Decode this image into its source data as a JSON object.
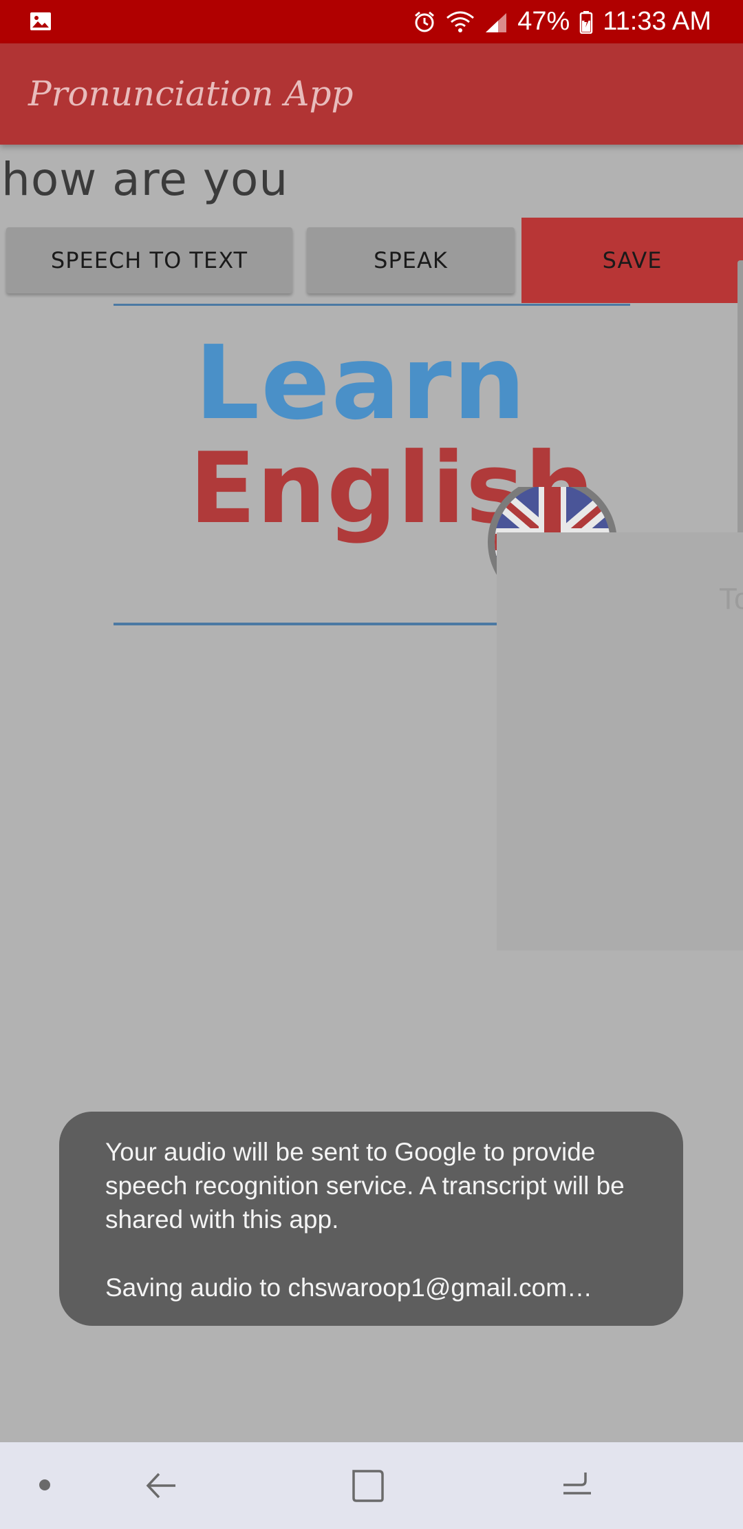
{
  "status_bar": {
    "battery": "47%",
    "time": "11:33 AM",
    "icons": [
      "image-icon",
      "alarm-icon",
      "wifi-icon",
      "signal-icon",
      "battery-icon"
    ]
  },
  "app": {
    "title": "Pronunciation App"
  },
  "main": {
    "phrase": "how are you",
    "buttons": {
      "speech_to_text": "SPEECH TO TEXT",
      "speak": "SPEAK",
      "save": "SAVE"
    },
    "image": {
      "learn": "Learn",
      "english": "English"
    },
    "ghost_text": "To"
  },
  "toast": {
    "line1": "Your audio will be sent to Google to provide speech recognition service. A transcript will be shared with this app.",
    "line2": "Saving audio to chswaroop1@gmail.com…"
  },
  "nav_bar": {
    "icons": [
      "dot-icon",
      "back-icon",
      "home-icon",
      "recents-icon"
    ]
  },
  "colors": {
    "status_bar": "#b00000",
    "app_bar": "#b13434",
    "save_button": "#b83636",
    "toast": "#5e5e5e"
  }
}
